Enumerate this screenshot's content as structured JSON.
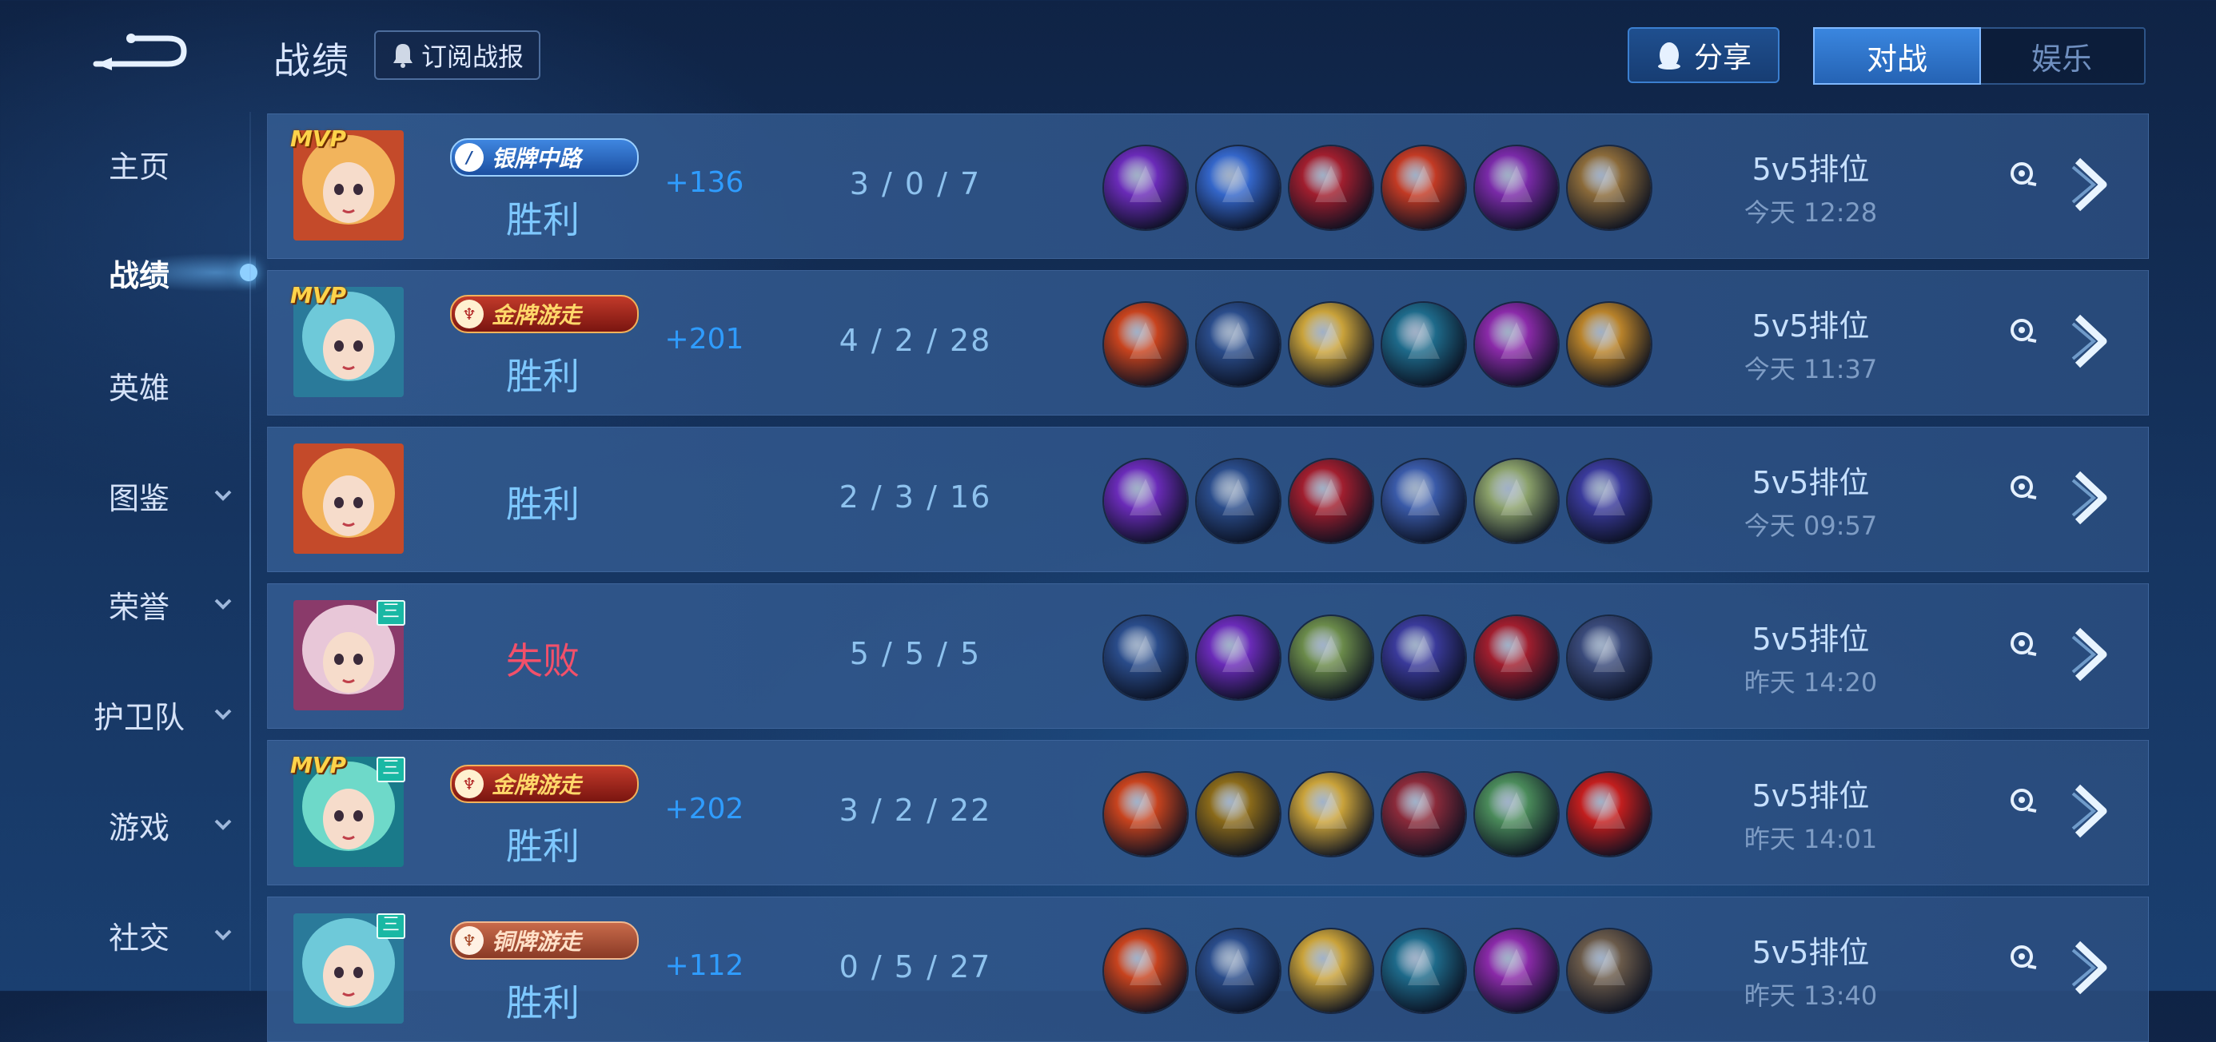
{
  "header": {
    "title": "战绩",
    "subscribe_label": "订阅战报",
    "share_label": "分享",
    "tabs": [
      {
        "label": "对战",
        "active": true
      },
      {
        "label": "娱乐",
        "active": false
      }
    ]
  },
  "sidebar": {
    "items": [
      {
        "label": "主页",
        "has_dropdown": false,
        "active": false
      },
      {
        "label": "战绩",
        "has_dropdown": false,
        "active": true
      },
      {
        "label": "英雄",
        "has_dropdown": false,
        "active": false
      },
      {
        "label": "图鉴",
        "has_dropdown": true,
        "active": false
      },
      {
        "label": "荣誉",
        "has_dropdown": true,
        "active": false
      },
      {
        "label": "护卫队",
        "has_dropdown": true,
        "active": false
      },
      {
        "label": "游戏",
        "has_dropdown": true,
        "active": false
      },
      {
        "label": "社交",
        "has_dropdown": true,
        "active": false
      }
    ]
  },
  "matches": [
    {
      "mvp": "MVP",
      "level_badge": "",
      "rank": "银牌中路",
      "rank_style": "silver",
      "result": "胜利",
      "points": "+136",
      "kda": "3 / 0 / 7",
      "mode": "5v5排位",
      "time": "今天 12:28"
    },
    {
      "mvp": "MVP",
      "level_badge": "",
      "rank": "金牌游走",
      "rank_style": "gold",
      "result": "胜利",
      "points": "+201",
      "kda": "4 / 2 / 28",
      "mode": "5v5排位",
      "time": "今天 11:37"
    },
    {
      "mvp": "",
      "level_badge": "",
      "rank": "",
      "rank_style": "",
      "result": "胜利",
      "points": "",
      "kda": "2 / 3 / 16",
      "mode": "5v5排位",
      "time": "今天 09:57"
    },
    {
      "mvp": "",
      "level_badge": "三",
      "rank": "",
      "rank_style": "",
      "result": "失败",
      "points": "",
      "kda": "5 / 5 / 5",
      "mode": "5v5排位",
      "time": "昨天 14:20"
    },
    {
      "mvp": "MVP",
      "level_badge": "三",
      "rank": "金牌游走",
      "rank_style": "gold",
      "result": "胜利",
      "points": "+202",
      "kda": "3 / 2 / 22",
      "mode": "5v5排位",
      "time": "昨天 14:01"
    },
    {
      "mvp": "",
      "level_badge": "三",
      "rank": "铜牌游走",
      "rank_style": "bronze",
      "result": "胜利",
      "points": "+112",
      "kda": "0 / 5 / 27",
      "mode": "5v5排位",
      "time": "昨天 13:40"
    }
  ],
  "item_palettes": [
    [
      "#6a2bb8",
      "#3466c9",
      "#a01e2e",
      "#c23a24",
      "#7a2aa8",
      "#8a6a3a"
    ],
    [
      "#c7431e",
      "#2a4c8a",
      "#c9a23a",
      "#1e6a8a",
      "#8a2aa8",
      "#b8822a"
    ],
    [
      "#6a2bb8",
      "#2a4c8a",
      "#a01e2e",
      "#3a5aa8",
      "#8aa06a",
      "#3a3a9a"
    ],
    [
      "#2a4c8a",
      "#6a2bb8",
      "#6a8a4a",
      "#3a3a9a",
      "#a01e2e",
      "#3a4a7a"
    ],
    [
      "#c7431e",
      "#8a6a1a",
      "#c9a23a",
      "#8a2a3a",
      "#4a8a5a",
      "#c21e1e"
    ],
    [
      "#c7431e",
      "#2a4c8a",
      "#c9a23a",
      "#1e6a8a",
      "#8a2aa8",
      "#6a5a4a"
    ]
  ],
  "hero_palettes": [
    [
      "#f2b45c",
      "#c44a2a"
    ],
    [
      "#6ec9d9",
      "#2a7a9a"
    ],
    [
      "#f2b45c",
      "#c44a2a"
    ],
    [
      "#e8c7d8",
      "#8a3a6a"
    ],
    [
      "#6ed9c9",
      "#1a7a8a"
    ],
    [
      "#6ec9d9",
      "#2a7a9a"
    ]
  ]
}
